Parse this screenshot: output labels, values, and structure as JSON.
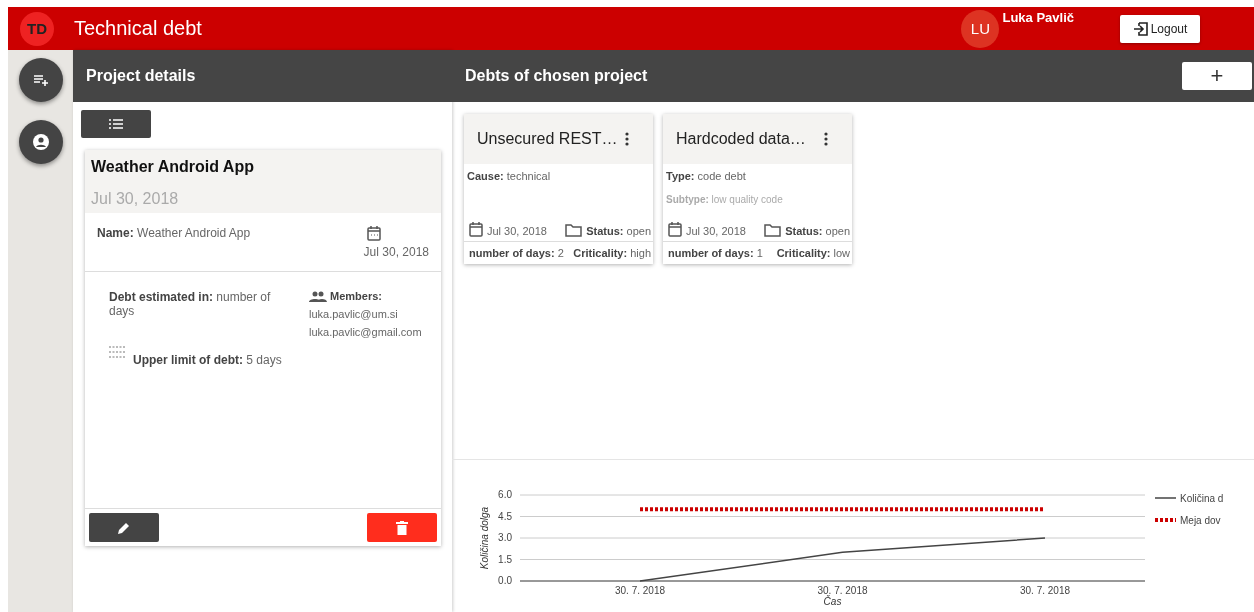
{
  "app_bar": {
    "logo": "TD",
    "title": "Technical debt",
    "avatar_initials": "LU",
    "user_name": "Luka Pavlič",
    "logout_label": "Logout"
  },
  "project_panel": {
    "title": "Project details",
    "project": {
      "name": "Weather Android App",
      "date": "Jul 30, 2018",
      "name_field": "**Name:** Weather Android App",
      "created": "Jul 30, 2018",
      "estimated_in": "**Debt estimated in:** number of days",
      "upper_limit": "**Upper limit of debt:** 5  days",
      "members_label": "Members:",
      "members": [
        "luka.pavlic@um.si",
        "luka.pavlic@gmail.com"
      ]
    }
  },
  "debts_panel": {
    "title": "Debts of chosen project",
    "add_label": "+",
    "debts": [
      {
        "title": "Unsecured REST…",
        "fields": [
          {
            "kind": "primary",
            "text": "**Cause:** technical"
          }
        ],
        "date": "Jul 30, 2018",
        "status": "**Status:** open",
        "days": "**number of days:** 2",
        "criticality": "**Criticality:** high"
      },
      {
        "title": "Hardcoded data…",
        "fields": [
          {
            "kind": "primary",
            "text": "**Type:** code debt"
          },
          {
            "kind": "secondary",
            "text": "**Subtype:** low quality code"
          }
        ],
        "date": "Jul 30, 2018",
        "status": "**Status:** open",
        "days": "**number of days:** 1",
        "criticality": "**Criticality:** low"
      }
    ],
    "chart_data": {
      "type": "line",
      "xlabel": "Čas",
      "ylabel": "Količina dolga",
      "categories": [
        "30. 7. 2018",
        "30. 7. 2018",
        "30. 7. 2018"
      ],
      "ylim": [
        0,
        6
      ],
      "grid": true,
      "legend": true,
      "yticks": [
        {
          "value": 0,
          "label": "0.0"
        },
        {
          "value": 1.5,
          "label": "1.5"
        },
        {
          "value": 3,
          "label": "3.0"
        },
        {
          "value": 4.5,
          "label": "4.5"
        },
        {
          "value": 6,
          "label": "6.0"
        }
      ],
      "series": [
        {
          "name": "Količina d",
          "color": "#444444",
          "line_style": "solid",
          "values": [
            0,
            2,
            3
          ]
        },
        {
          "name": "Meja dov",
          "color": "#cc0000",
          "line_style": "dotted",
          "values": [
            5,
            5,
            5
          ]
        }
      ]
    }
  }
}
